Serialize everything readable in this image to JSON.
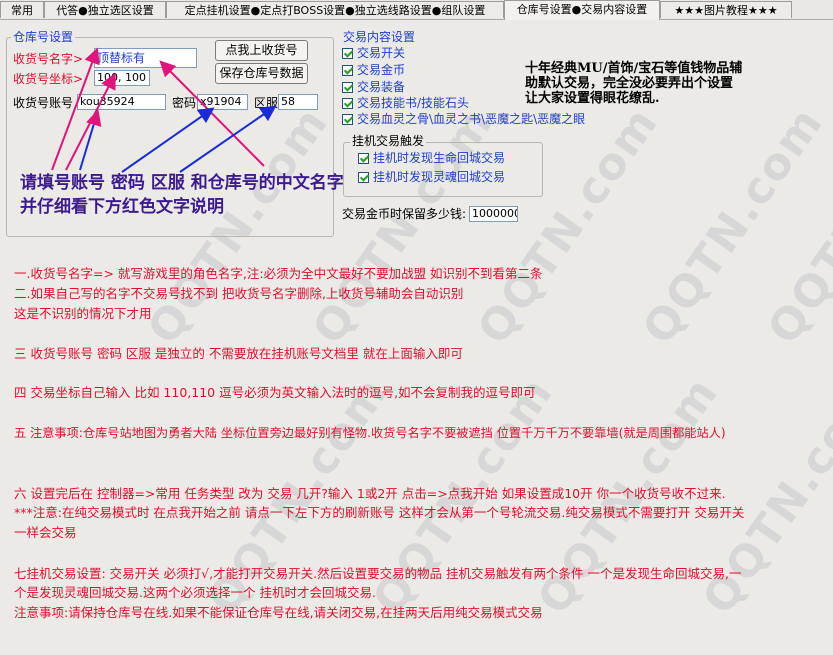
{
  "tabs": [
    {
      "label": "常用"
    },
    {
      "label": "代答●独立选区设置"
    },
    {
      "label": "定点挂机设置●定点打BOSS设置●独立选线路设置●组队设置"
    },
    {
      "label": "仓库号设置●交易内容设置"
    },
    {
      "label": "★★★图片教程★★★"
    }
  ],
  "warehouse": {
    "title": "仓库号设置",
    "name_label": "收货号名字>",
    "name_value": "顶替标有",
    "coord_label": "收货号坐标>",
    "coord_value": "100, 100",
    "account_label": "收货号账号",
    "account_value": "kou35924",
    "password_label": "密码",
    "password_value": "x91904",
    "server_label": "区服",
    "server_value": "58",
    "btn_online": "点我上收货号",
    "btn_save": "保存仓库号数据"
  },
  "annotation": {
    "line1": "请填号账号 密码 区服 和仓库号的中文名字",
    "line2": "并仔细看下方红色文字说明"
  },
  "trade": {
    "title": "交易内容设置",
    "items": [
      "交易开关",
      "交易金币",
      "交易装备",
      "交易技能书/技能石头",
      "交易血灵之骨\\血灵之书\\恶魔之匙\\恶魔之眼"
    ],
    "trigger_title": "挂机交易触发",
    "triggers": [
      "挂机时发现生命回城交易",
      "挂机时发现灵魂回城交易"
    ],
    "gold_label": "交易金币时保留多少钱:",
    "gold_value": "1000000"
  },
  "ad": {
    "line1": "十年经典MU/首饰/宝石等值钱物品辅",
    "line2": "助默认交易，完全没必要弄出个设置",
    "line3": "让大家设置得眼花缭乱."
  },
  "instructions": [
    "一.收货号名字=> 就写游戏里的角色名字,注:必须为全中文最好不要加战盟 如识别不到看第二条",
    "二.如果自己写的名字不交易号找不到 把收货号名字删除,上收货号辅助会自动识别",
    "这是不识别的情况下才用",
    "",
    "三 收货号账号 密码 区服 是独立的 不需要放在挂机账号文档里 就在上面输入即可",
    "",
    "四 交易坐标自己输入 比如 110,110 逗号必须为英文输入法时的逗号,如不会复制我的逗号即可",
    "",
    "五 注意事项:仓库号站地图为勇者大陆 坐标位置旁边最好别有怪物.收货号名字不要被遮挡 位置千万千万不要靠墙(就是周围都能站人)",
    "",
    "",
    "六 设置完后在 控制器=>常用 任务类型 改为 交易  几开?输入 1或2开 点击=>点我开始 如果设置成10开 你一个收货号收不过来.",
    "***注意:在纯交易模式时 在点我开始之前 请点一下左下方的刷新账号 这样才会从第一个号轮流交易.纯交易模式不需要打开 交易开关",
    "一样会交易",
    "",
    "七挂机交易设置: 交易开关 必须打√,才能打开交易开关.然后设置要交易的物品 挂机交易触发有两个条件 一个是发现生命回城交易,一",
    "个是发现灵魂回城交易.这两个必须选择一个 挂机时才会回城交易.",
    "注意事项:请保持仓库号在线.如果不能保证仓库号在线,请关闭交易,在挂两天后用纯交易模式交易"
  ],
  "watermark": "QQTN.com",
  "colors": {
    "accent": "#1f3fc8",
    "warning": "#e0102c",
    "annotation": "#3c1a90",
    "arrow_pink": "#e0147a",
    "arrow_blue": "#1b2bd6"
  }
}
